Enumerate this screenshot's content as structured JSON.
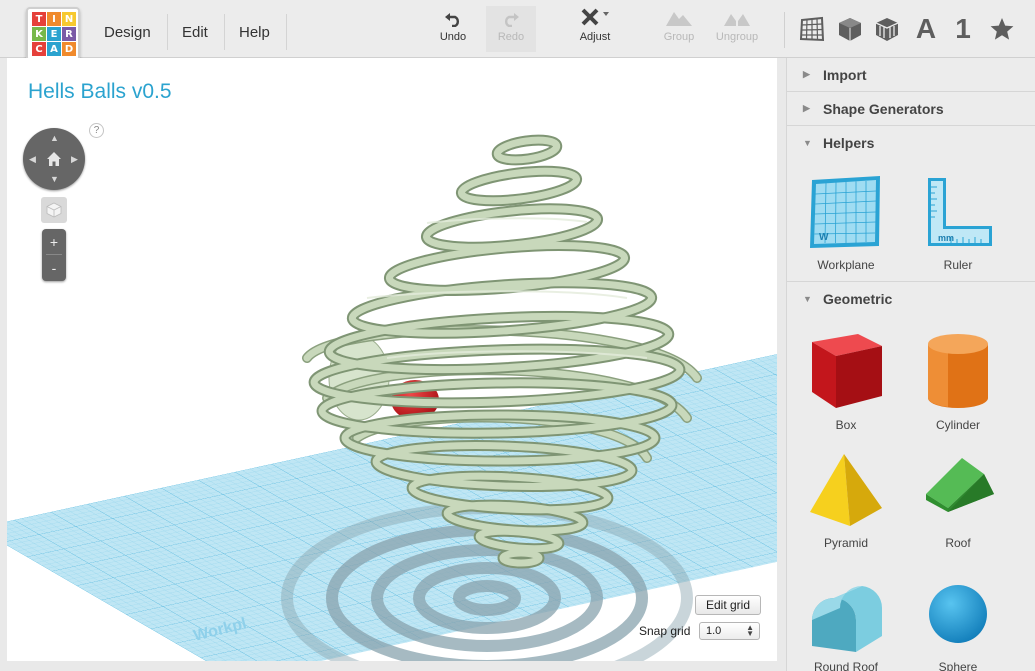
{
  "logo": {
    "letters": [
      "T",
      "I",
      "N",
      "K",
      "E",
      "R",
      "C",
      "A",
      "D"
    ],
    "colors": [
      "#e5403a",
      "#f08a2c",
      "#f7c92f",
      "#77b84a",
      "#2ba3cf",
      "#7b5aa6",
      "#e5403a",
      "#2ba3cf",
      "#f08a2c"
    ]
  },
  "menu": {
    "design": "Design",
    "edit": "Edit",
    "help": "Help"
  },
  "toolbar": {
    "undo": "Undo",
    "redo": "Redo",
    "adjust": "Adjust",
    "group": "Group",
    "ungroup": "Ungroup"
  },
  "view_tools": {
    "grid_icon": "grid-view-icon",
    "box_icon": "box-view-icon",
    "wire_icon": "wireframe-view-icon",
    "letter": "A",
    "number": "1",
    "star_icon": "star-icon"
  },
  "design": {
    "title": "Hells Balls v0.5"
  },
  "viewport": {
    "help": "?",
    "zoom_in": "+",
    "zoom_out": "-",
    "workplane_watermark": "Workpl",
    "edit_grid": "Edit grid",
    "snap_label": "Snap grid",
    "snap_value": "1.0"
  },
  "sidebar": {
    "import": "Import",
    "shape_generators": "Shape Generators",
    "helpers": "Helpers",
    "helper_items": [
      {
        "label": "Workplane"
      },
      {
        "label": "Ruler"
      }
    ],
    "workplane_letter": "W",
    "ruler_unit": "mm",
    "geometric": "Geometric",
    "geometric_items": [
      {
        "label": "Box"
      },
      {
        "label": "Cylinder"
      },
      {
        "label": "Pyramid"
      },
      {
        "label": "Roof"
      },
      {
        "label": "Round Roof"
      },
      {
        "label": "Sphere"
      }
    ]
  },
  "colors": {
    "accent": "#2ba3cf",
    "box": "#d81e25",
    "cylinder": "#e5751e",
    "pyramid": "#f2c811",
    "roof": "#3aa03a",
    "round_roof": "#6cc3d6",
    "sphere": "#1c9ad6",
    "spiral": "#c8d8bb",
    "ball": "#d81e25"
  }
}
